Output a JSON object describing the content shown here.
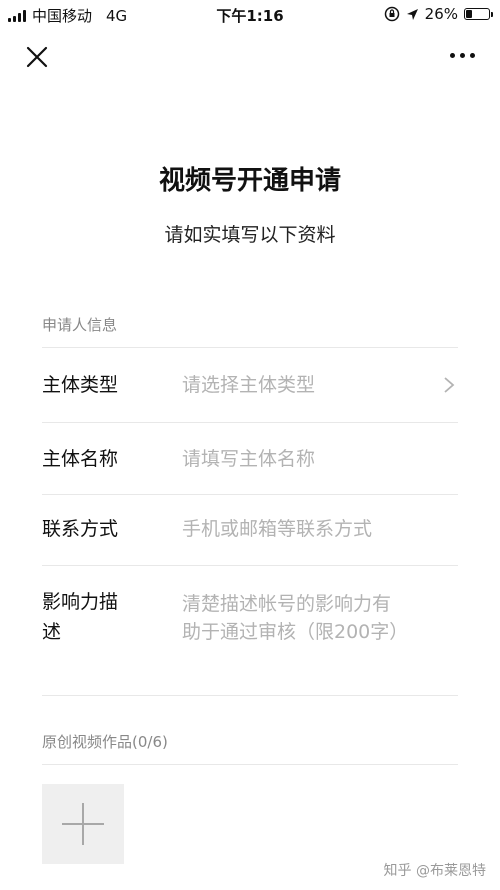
{
  "status_bar": {
    "carrier": "中国移动",
    "network": "4G",
    "time": "下午1:16",
    "battery": "26%",
    "battery_level": 0.26
  },
  "nav": {
    "close_icon": "close-icon",
    "more_icon": "more-icon"
  },
  "header": {
    "title": "视频号开通申请",
    "subtitle": "请如实填写以下资料"
  },
  "form": {
    "section_applicant": "申请人信息",
    "fields": [
      {
        "label": "主体类型",
        "placeholder": "请选择主体类型"
      },
      {
        "label": "主体名称",
        "placeholder": "请填写主体名称"
      },
      {
        "label": "联系方式",
        "placeholder": "手机或邮箱等联系方式"
      },
      {
        "label": "影响力描述",
        "label_line1": "影响力描",
        "label_line2": "述",
        "placeholder_line1": "清楚描述帐号的影响力有",
        "placeholder_line2": "助于通过审核（限200字）"
      }
    ],
    "section_videos": "原创视频作品(0/6)"
  },
  "watermark": "知乎 @布莱恩特"
}
